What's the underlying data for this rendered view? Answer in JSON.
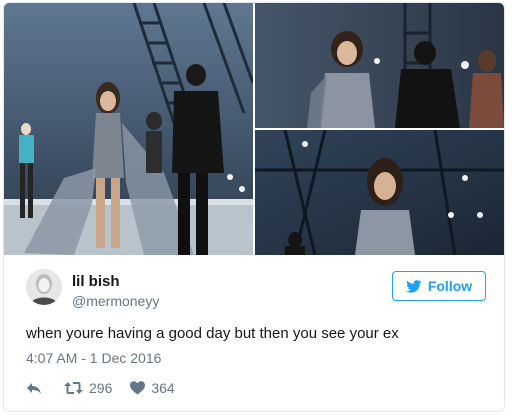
{
  "tweet": {
    "display_name": "lil bish",
    "handle": "@mermoneyy",
    "text": "when youre having a good day but then you see your ex",
    "timestamp": "4:07 AM - 1 Dec 2016",
    "follow_label": "Follow"
  },
  "stats": {
    "retweets": "296",
    "likes": "364"
  },
  "icons": {
    "follow": "twitter-bird-icon",
    "reply": "reply-icon",
    "retweet": "retweet-icon",
    "like": "heart-icon"
  },
  "colors": {
    "accent": "#1da1f2",
    "text": "#14171a",
    "muted": "#657786",
    "border": "#e1e8ed"
  },
  "media": {
    "photos": [
      "runway-photo-main",
      "runway-photo-top-right",
      "runway-photo-bottom-right"
    ]
  }
}
